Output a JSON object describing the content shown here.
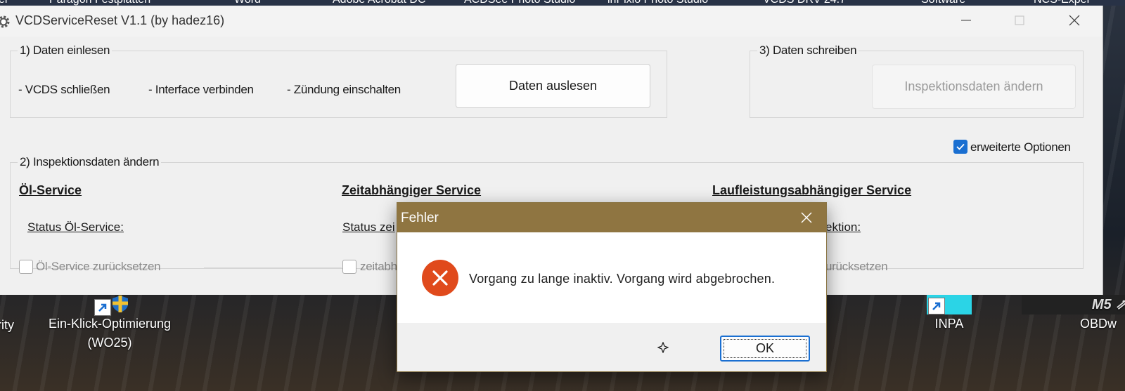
{
  "desktop": {
    "top_labels": [
      "el",
      "Paragon Festplatten",
      "Word",
      "Adobe Acrobat DC",
      "ACDSee Photo Studio",
      "inPixio Photo Studio",
      "VCDS DRV 24.7",
      "Software",
      "NCS-Exper"
    ],
    "icons": [
      {
        "label": "rity"
      },
      {
        "label": "Ein-Klick-Optimierung",
        "label2": "(WO25)"
      },
      {
        "label": "INPA"
      },
      {
        "label": "OBDw"
      }
    ]
  },
  "window": {
    "title": "VCDServiceReset V1.1 (by hadez16)",
    "group1": {
      "label": "1) Daten einlesen",
      "step1": "- VCDS schließen",
      "step2": "- Interface verbinden",
      "step3": "- Zündung einschalten",
      "button": "Daten auslesen"
    },
    "group3": {
      "label": "3) Daten schreiben",
      "button": "Inspektionsdaten ändern"
    },
    "advanced": {
      "label": "erweiterte Optionen",
      "checked": true
    },
    "group2": {
      "label": "2) Inspektionsdaten ändern",
      "col1": {
        "heading": "Öl-Service",
        "status": "Status Öl-Service:",
        "reset": "Öl-Service zurücksetzen"
      },
      "col2": {
        "heading": "Zeitabhängiger Service",
        "status": "Status zei",
        "reset": "zeitabh"
      },
      "col3": {
        "heading": "Laufleistungsabhängiger Service",
        "status": "ektion:",
        "reset": "urücksetzen"
      }
    }
  },
  "dialog": {
    "title": "Fehler",
    "message": "Vorgang zu lange inaktiv. Vorgang wird abgebrochen.",
    "ok": "OK",
    "accent_color": "#8f7541",
    "error_color": "#e04a1c"
  }
}
